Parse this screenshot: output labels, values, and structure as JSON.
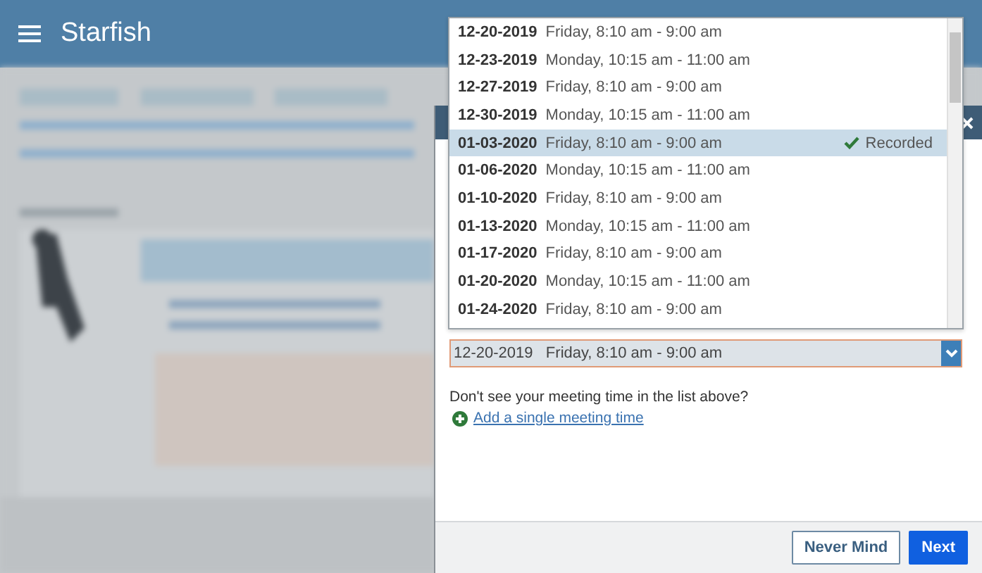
{
  "app": {
    "title": "Starfish"
  },
  "dialog": {
    "options": [
      {
        "date": "12-20-2019",
        "time": "Friday, 8:10 am - 9:00 am",
        "selected": false
      },
      {
        "date": "12-23-2019",
        "time": "Monday, 10:15 am - 11:00 am",
        "selected": false
      },
      {
        "date": "12-27-2019",
        "time": "Friday, 8:10 am - 9:00 am",
        "selected": false
      },
      {
        "date": "12-30-2019",
        "time": "Monday, 10:15 am - 11:00 am",
        "selected": false
      },
      {
        "date": "01-03-2020",
        "time": "Friday, 8:10 am - 9:00 am",
        "selected": true,
        "status": "Recorded"
      },
      {
        "date": "01-06-2020",
        "time": "Monday, 10:15 am - 11:00 am",
        "selected": false
      },
      {
        "date": "01-10-2020",
        "time": "Friday, 8:10 am - 9:00 am",
        "selected": false
      },
      {
        "date": "01-13-2020",
        "time": "Monday, 10:15 am - 11:00 am",
        "selected": false
      },
      {
        "date": "01-17-2020",
        "time": "Friday, 8:10 am - 9:00 am",
        "selected": false
      },
      {
        "date": "01-20-2020",
        "time": "Monday, 10:15 am - 11:00 am",
        "selected": false
      },
      {
        "date": "01-24-2020",
        "time": "Friday, 8:10 am - 9:00 am",
        "selected": false
      }
    ],
    "select": {
      "value": "12-20-2019   Friday, 8:10 am - 9:00 am"
    },
    "hint": "Don't see your meeting time in the list above?",
    "add_link": "Add a single meeting time",
    "buttons": [
      {
        "label": "Never Mind",
        "kind": "secondary"
      },
      {
        "label": "Next",
        "kind": "primary"
      }
    ]
  }
}
